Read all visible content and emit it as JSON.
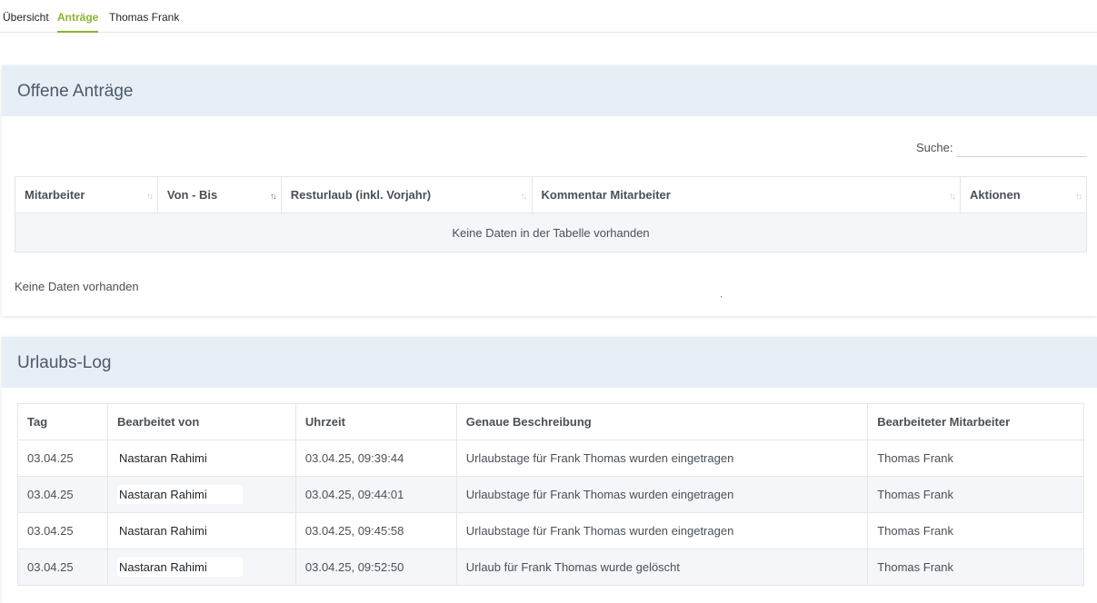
{
  "tabs": [
    {
      "label": "Übersicht"
    },
    {
      "label": "Anträge"
    },
    {
      "label": "Thomas Frank"
    }
  ],
  "open_requests": {
    "title": "Offene Anträge",
    "search_label": "Suche:",
    "search_value": "",
    "columns": [
      "Mitarbeiter",
      "Von - Bis",
      "Resturlaub (inkl. Vorjahr)",
      "Kommentar Mitarbeiter",
      "Aktionen"
    ],
    "empty_table": "Keine Daten in der Tabelle vorhanden",
    "no_data": "Keine Daten vorhanden"
  },
  "log": {
    "title": "Urlaubs-Log",
    "columns": [
      "Tag",
      "Bearbeitet von",
      "Uhrzeit",
      "Genaue Beschreibung",
      "Bearbeiteter Mitarbeiter"
    ],
    "rows": [
      {
        "day": "03.04.25",
        "by": "Nastaran Rahimi",
        "time": "03.04.25, 09:39:44",
        "desc": "Urlaubstage für Frank Thomas wurden eingetragen",
        "employee": "Thomas Frank"
      },
      {
        "day": "03.04.25",
        "by": "Nastaran Rahimi",
        "time": "03.04.25, 09:44:01",
        "desc": "Urlaubstage für Frank Thomas wurden eingetragen",
        "employee": "Thomas Frank"
      },
      {
        "day": "03.04.25",
        "by": "Nastaran Rahimi",
        "time": "03.04.25, 09:45:58",
        "desc": "Urlaubstage für Frank Thomas wurden eingetragen",
        "employee": "Thomas Frank"
      },
      {
        "day": "03.04.25",
        "by": "Nastaran Rahimi",
        "time": "03.04.25, 09:52:50",
        "desc": "Urlaub für Frank Thomas wurde gelöscht",
        "employee": "Thomas Frank"
      }
    ]
  },
  "colors": {
    "accent": "#8bb330",
    "header_bg": "#e8eef5"
  }
}
